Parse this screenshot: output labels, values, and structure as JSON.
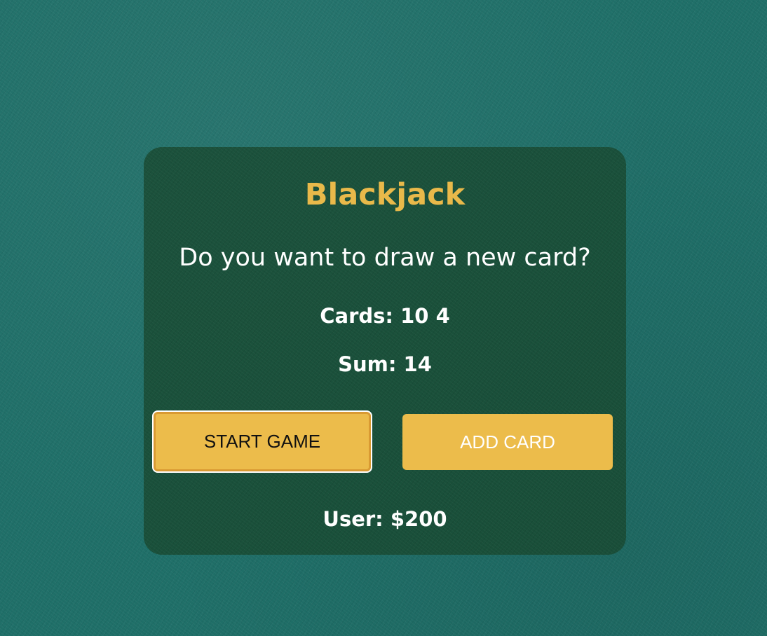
{
  "game": {
    "title": "Blackjack",
    "message": "Do you want to draw a new card?",
    "cards_text": "Cards: 10 4",
    "sum_text": "Sum: 14",
    "player_text": "User: $200"
  },
  "buttons": {
    "start_label": "START GAME",
    "add_label": "ADD CARD"
  },
  "colors": {
    "felt_background": "#1f6f68",
    "panel": "#1b4a33",
    "accent_gold": "#e9b94a",
    "button_fill": "#ecbc4b",
    "text": "#ffffff"
  }
}
